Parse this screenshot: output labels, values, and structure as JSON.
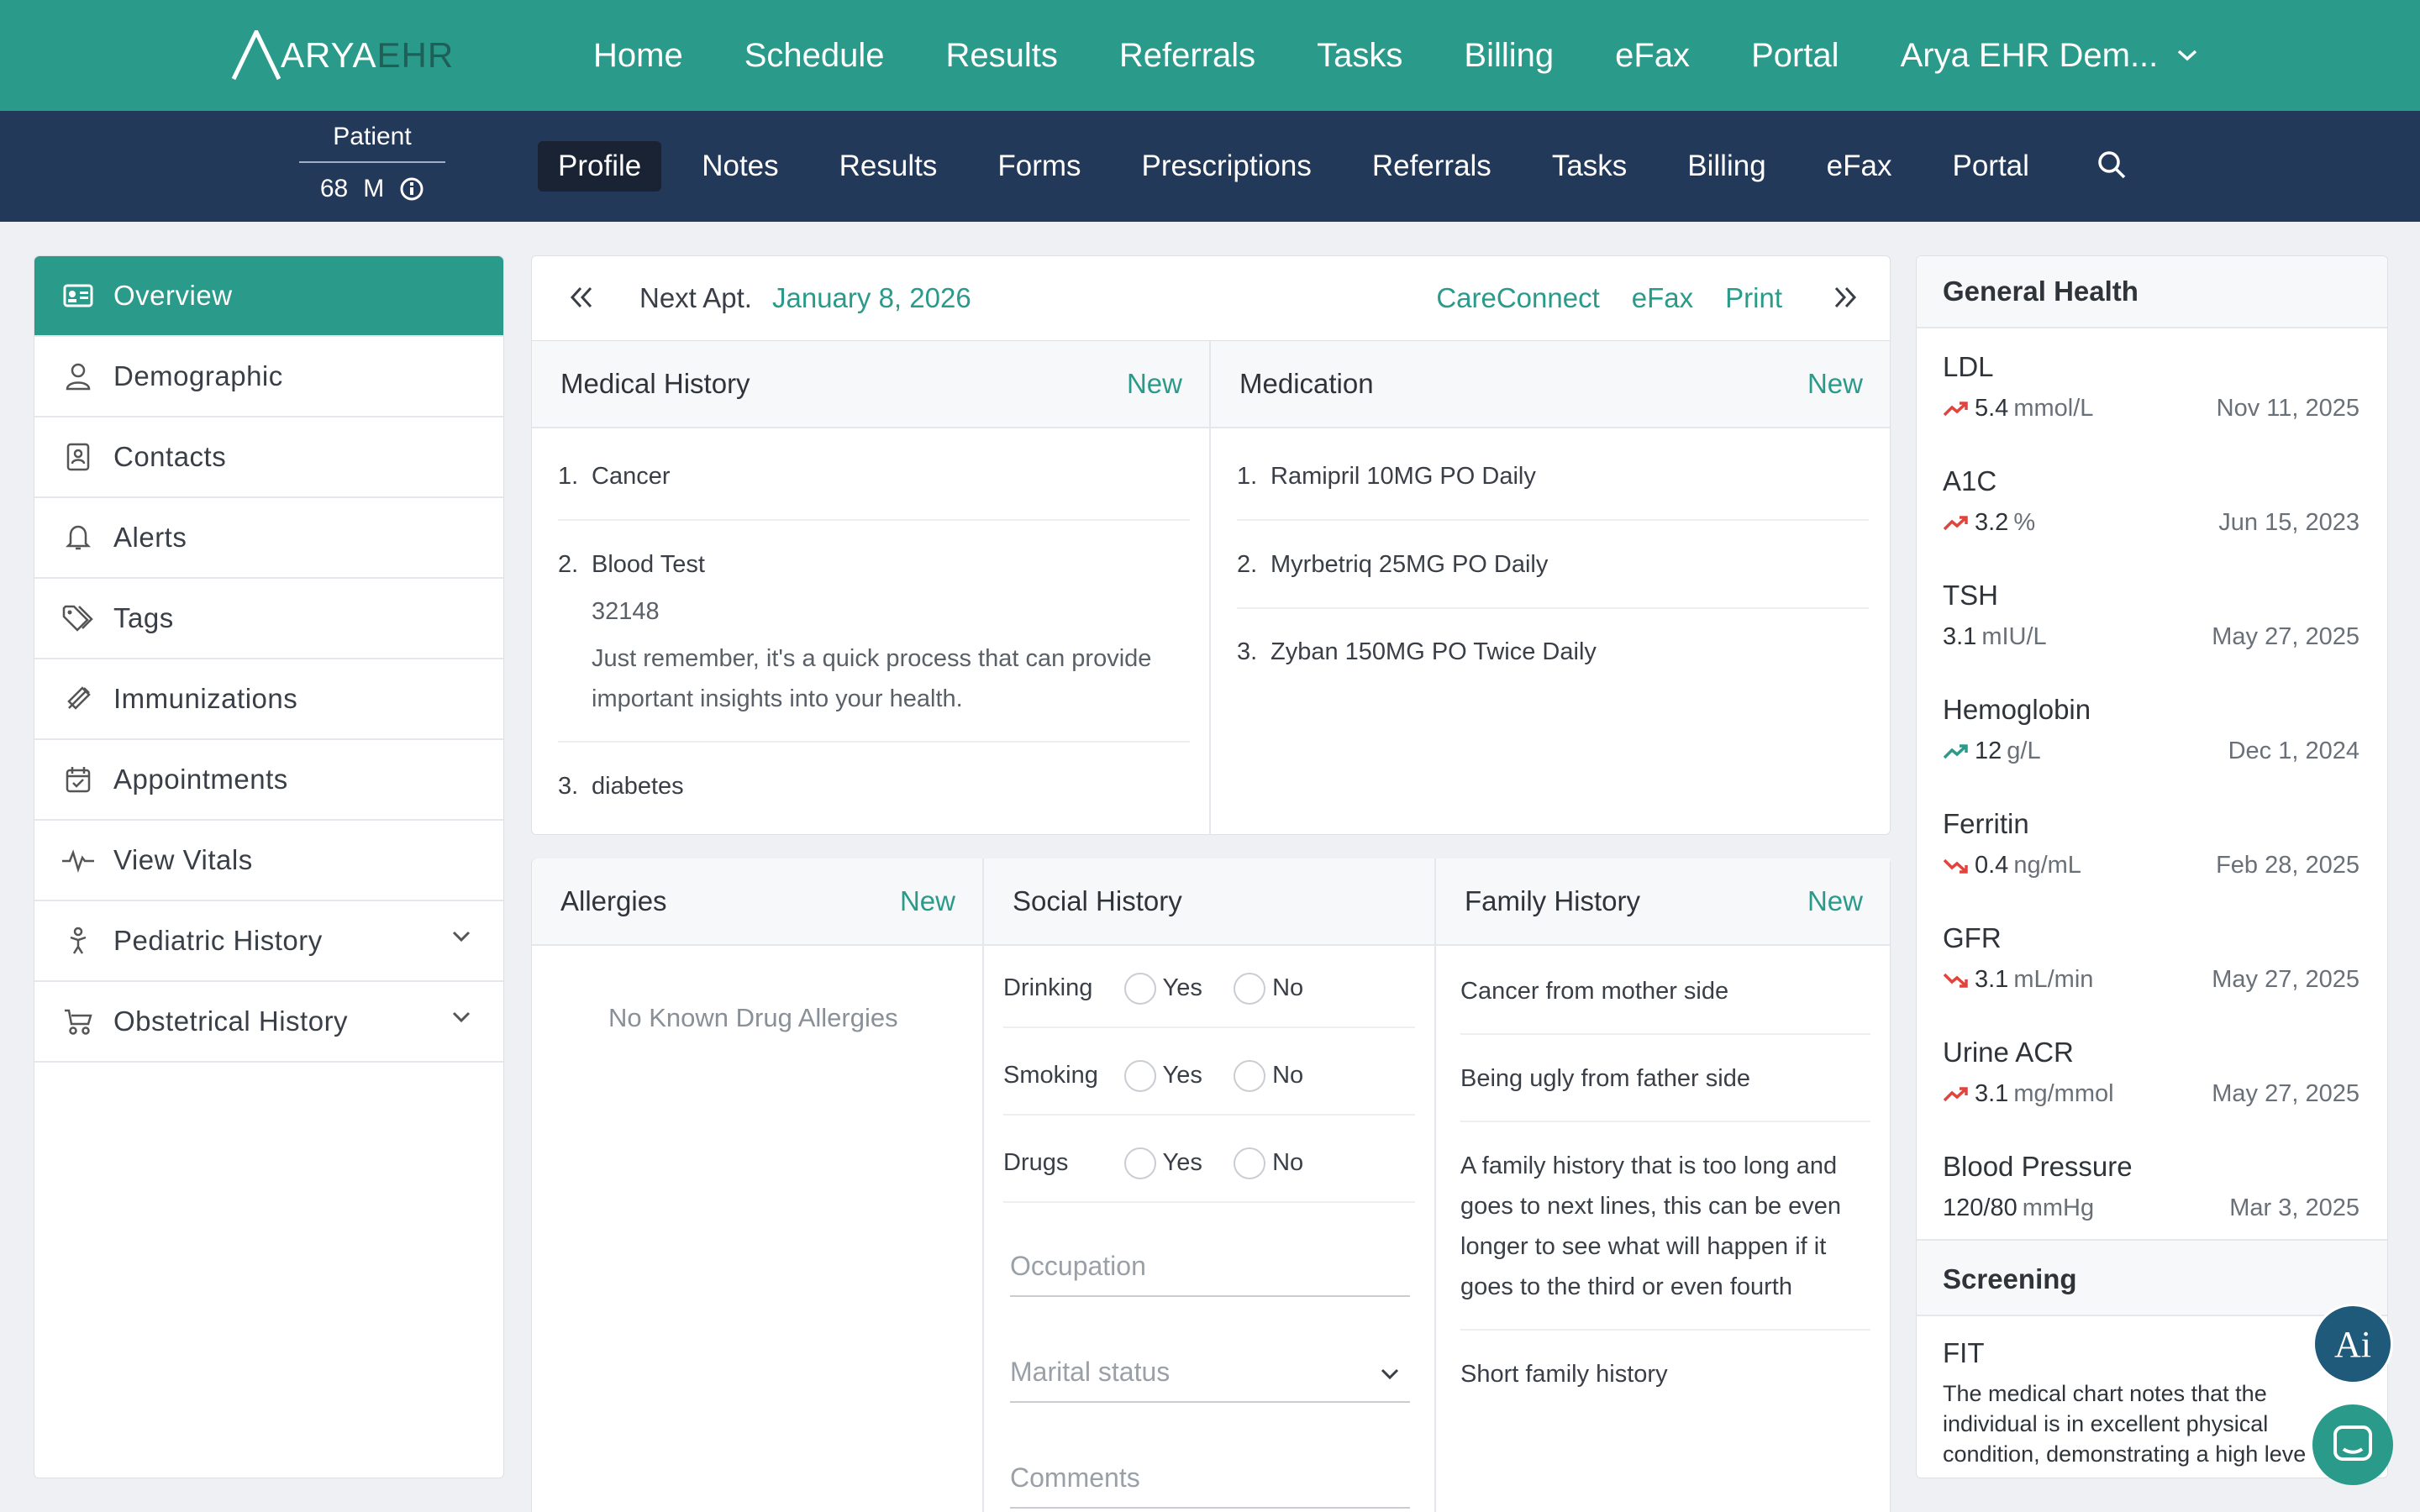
{
  "app": {
    "logo_main": "ARYA",
    "logo_suffix": "EHR",
    "top_nav": [
      "Home",
      "Schedule",
      "Results",
      "Referrals",
      "Tasks",
      "Billing",
      "eFax",
      "Portal"
    ],
    "account_label": "Arya EHR Dem..."
  },
  "patient": {
    "label": "Patient",
    "age": "68",
    "sex": "M"
  },
  "sub_nav": [
    "Profile",
    "Notes",
    "Results",
    "Forms",
    "Prescriptions",
    "Referrals",
    "Tasks",
    "Billing",
    "eFax",
    "Portal"
  ],
  "sidebar": [
    {
      "label": "Overview",
      "icon": "id-card-icon",
      "active": true
    },
    {
      "label": "Demographic",
      "icon": "user-icon"
    },
    {
      "label": "Contacts",
      "icon": "contacts-icon"
    },
    {
      "label": "Alerts",
      "icon": "bell-icon"
    },
    {
      "label": "Tags",
      "icon": "tag-icon"
    },
    {
      "label": "Immunizations",
      "icon": "syringe-icon"
    },
    {
      "label": "Appointments",
      "icon": "calendar-check-icon"
    },
    {
      "label": "View Vitals",
      "icon": "pulse-icon"
    },
    {
      "label": "Pediatric History",
      "icon": "child-icon",
      "expandable": true
    },
    {
      "label": "Obstetrical History",
      "icon": "stroller-icon",
      "expandable": true
    }
  ],
  "appointment": {
    "label": "Next Apt.",
    "date": "January 8, 2026",
    "links": [
      "CareConnect",
      "eFax",
      "Print"
    ]
  },
  "medical_history": {
    "title": "Medical History",
    "new_label": "New",
    "items": [
      {
        "num": "1.",
        "text": "Cancer"
      },
      {
        "num": "2.",
        "text": "Blood Test",
        "code": "32148",
        "note_line1": "Just remember, it's a quick process that can provide",
        "note_line2": "important insights into your health."
      },
      {
        "num": "3.",
        "text": "diabetes"
      }
    ]
  },
  "medication": {
    "title": "Medication",
    "new_label": "New",
    "items": [
      {
        "num": "1.",
        "text": "Ramipril 10MG PO Daily"
      },
      {
        "num": "2.",
        "text": "Myrbetriq 25MG PO Daily"
      },
      {
        "num": "3.",
        "text": "Zyban 150MG PO Twice Daily"
      }
    ]
  },
  "allergies": {
    "title": "Allergies",
    "new_label": "New",
    "empty_text": "No Known Drug Allergies"
  },
  "social_history": {
    "title": "Social History",
    "rows": [
      {
        "label": "Drinking",
        "yes": "Yes",
        "no": "No"
      },
      {
        "label": "Smoking",
        "yes": "Yes",
        "no": "No"
      },
      {
        "label": "Drugs",
        "yes": "Yes",
        "no": "No"
      }
    ],
    "occupation_placeholder": "Occupation",
    "marital_placeholder": "Marital status",
    "comments_placeholder": "Comments"
  },
  "family_history": {
    "title": "Family History",
    "new_label": "New",
    "items": [
      {
        "lines": [
          "Cancer from mother side"
        ]
      },
      {
        "lines": [
          "Being ugly from father side"
        ]
      },
      {
        "lines": [
          "A family history that is too long and",
          "goes to next lines, this can be even",
          "longer to see what will happen if it",
          "goes to the third or even fourth"
        ]
      },
      {
        "lines": [
          "Short family history"
        ]
      }
    ]
  },
  "general_health": {
    "title": "General Health",
    "items": [
      {
        "name": "LDL",
        "value": "5.4",
        "unit": "mmol/L",
        "date": "Nov 11, 2025",
        "trend": "up",
        "trend_color": "#e0443c"
      },
      {
        "name": "A1C",
        "value": "3.2",
        "unit": "%",
        "date": "Jun 15, 2023",
        "trend": "up",
        "trend_color": "#e0443c"
      },
      {
        "name": "TSH",
        "value": "3.1",
        "unit": "mIU/L",
        "date": "May 27, 2025",
        "trend": "none"
      },
      {
        "name": "Hemoglobin",
        "value": "12",
        "unit": "g/L",
        "date": "Dec 1, 2024",
        "trend": "up",
        "trend_color": "#2a9a8a"
      },
      {
        "name": "Ferritin",
        "value": "0.4",
        "unit": "ng/mL",
        "date": "Feb 28, 2025",
        "trend": "down",
        "trend_color": "#e0443c"
      },
      {
        "name": "GFR",
        "value": "3.1",
        "unit": "mL/min",
        "date": "May 27, 2025",
        "trend": "down",
        "trend_color": "#e0443c"
      },
      {
        "name": "Urine ACR",
        "value": "3.1",
        "unit": "mg/mmol",
        "date": "May 27, 2025",
        "trend": "up",
        "trend_color": "#e0443c"
      },
      {
        "name": "Blood Pressure",
        "value": "120/80",
        "unit": "mmHg",
        "date": "Mar 3, 2025",
        "trend": "none"
      }
    ]
  },
  "screening": {
    "title": "Screening",
    "name": "FIT",
    "text_lines": [
      "The medical chart notes that the",
      "individual is in excellent physical",
      "condition, demonstrating a high leve"
    ]
  },
  "fabs": {
    "ai_label": "Ai"
  },
  "colors": {
    "teal": "#2a9a8a",
    "navy": "#23395a",
    "red": "#e0443c"
  }
}
